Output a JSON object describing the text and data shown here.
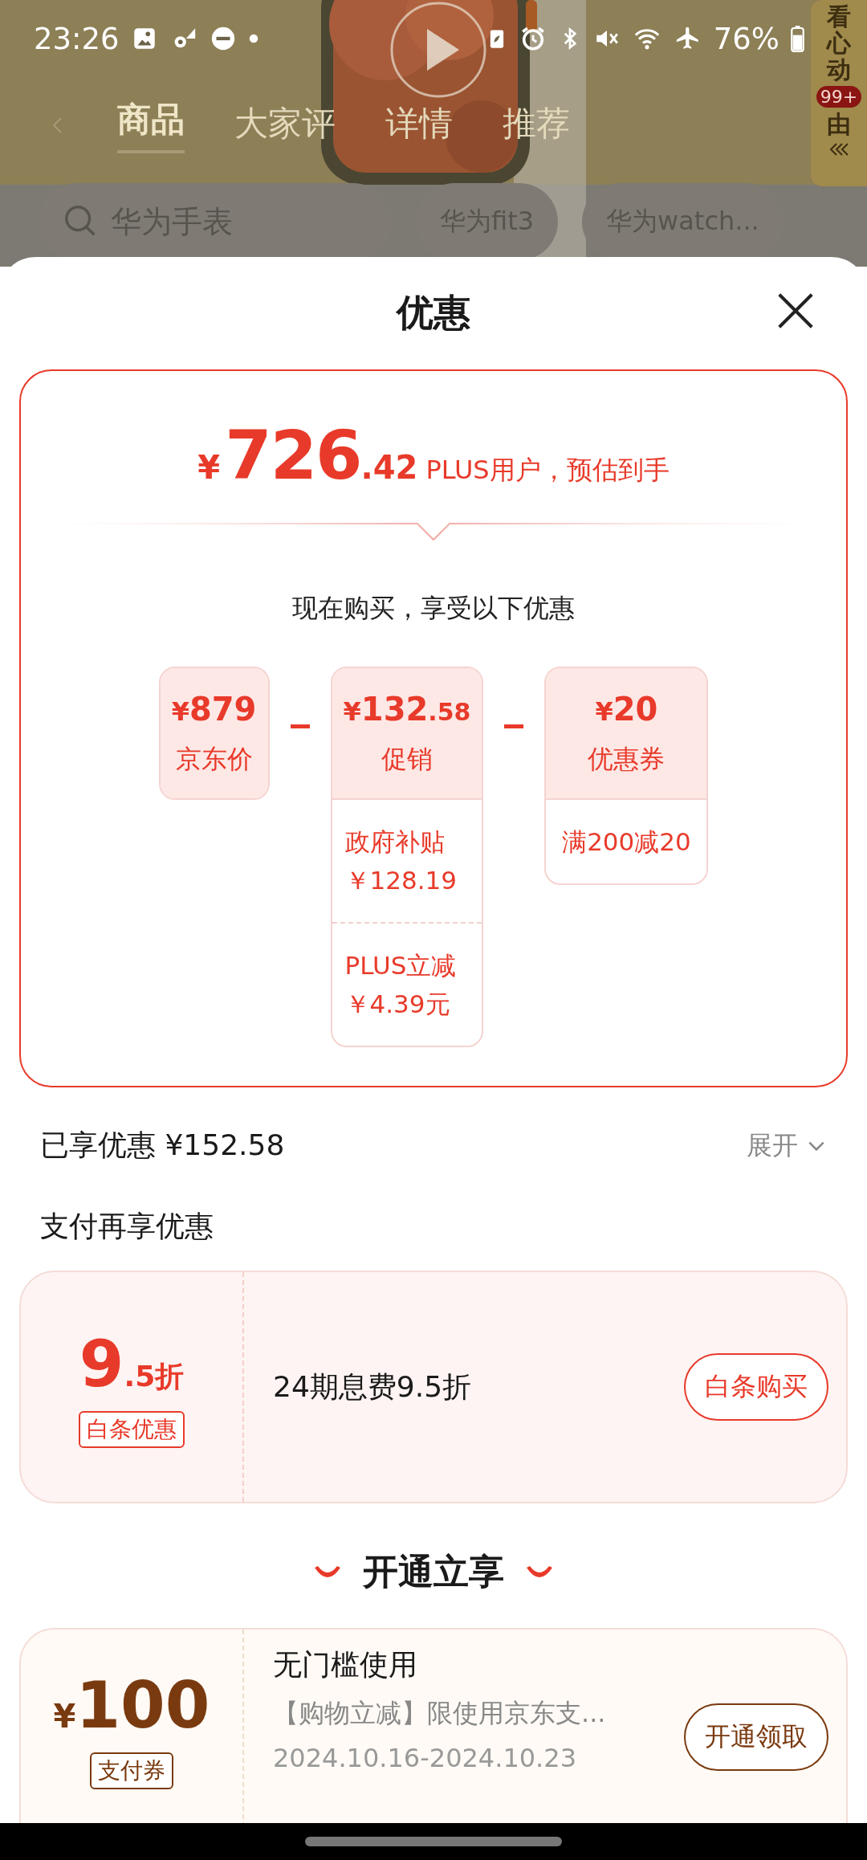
{
  "status_bar": {
    "time": "23:26",
    "battery": "76%"
  },
  "product_page": {
    "tabs": [
      {
        "label": "商品",
        "selected": true
      },
      {
        "label": "大家评",
        "selected": false
      },
      {
        "label": "详情",
        "selected": false
      },
      {
        "label": "推荐",
        "selected": false
      }
    ],
    "side_banner": {
      "text_top": "看心动",
      "badge": "99+",
      "text_bottom": "由"
    },
    "search": {
      "placeholder": "华为手表"
    },
    "chips": [
      "华为fit3",
      "华为watch..."
    ]
  },
  "sheet": {
    "title": "优惠",
    "estimate": {
      "currency": "¥",
      "integer": "726",
      "decimal": ".42",
      "note": "PLUS用户，预估到手"
    },
    "subtitle": "现在购买，享受以下优惠",
    "breakdown": [
      {
        "currency": "¥",
        "amount": "879",
        "label": "京东价"
      },
      {
        "currency": "¥",
        "amount": "132",
        "decimal": ".58",
        "label": "促销",
        "details": [
          {
            "name": "政府补贴",
            "value": "￥128.19"
          },
          {
            "name": "PLUS立减",
            "value": "￥4.39元"
          }
        ]
      },
      {
        "currency": "¥",
        "amount": "20",
        "label": "优惠券",
        "details": [
          {
            "name": "满200减20"
          }
        ]
      }
    ],
    "savings": {
      "label": "已享优惠 ¥152.58",
      "toggle": "展开",
      "expanded": false
    },
    "pay_section": {
      "title": "支付再享优惠",
      "offer": {
        "big": "9",
        "small": ".5折",
        "tag": "白条优惠",
        "description": "24期息费9.5折",
        "button": "白条购买"
      }
    },
    "membership": {
      "title": "开通立享",
      "coupon": {
        "currency": "¥",
        "amount": "100",
        "tag": "支付券",
        "title": "无门槛使用",
        "description": "【购物立减】限使用京东支...",
        "dates": "2024.10.16-2024.10.23",
        "button": "开通领取"
      }
    }
  }
}
